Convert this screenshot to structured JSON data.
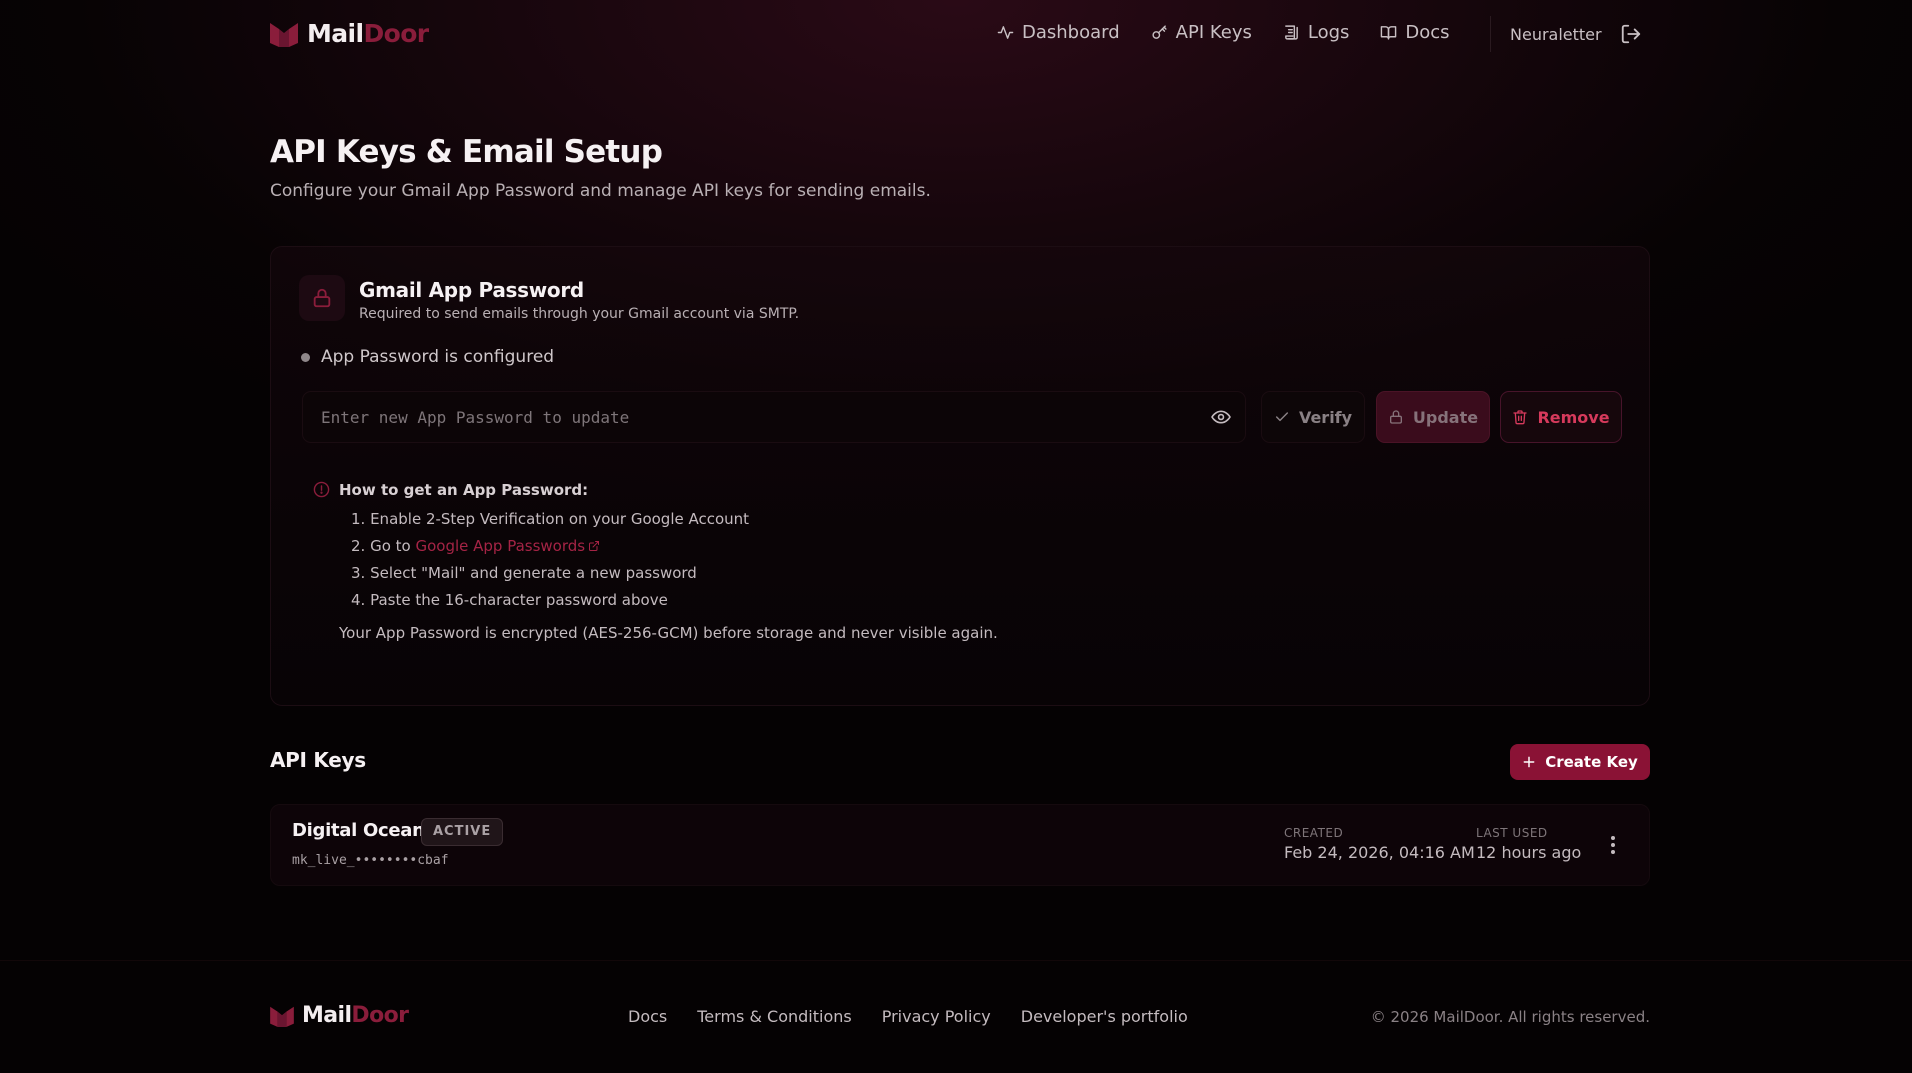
{
  "brand": {
    "name_part1": "Mail",
    "name_part2": "Door",
    "accent_color": "#8a1d3b"
  },
  "nav": {
    "items": [
      {
        "label": "Dashboard",
        "icon": "activity-icon"
      },
      {
        "label": "API Keys",
        "icon": "key-icon"
      },
      {
        "label": "Logs",
        "icon": "scroll-icon"
      },
      {
        "label": "Docs",
        "icon": "book-icon"
      }
    ],
    "user_name": "Neuraletter",
    "logout_icon": "logout-icon"
  },
  "page": {
    "title": "API Keys & Email Setup",
    "subtitle": "Configure your Gmail App Password and manage API keys for sending emails."
  },
  "gmail": {
    "title": "Gmail App Password",
    "description": "Required to send emails through your Gmail account via SMTP.",
    "status": "App Password is configured",
    "input_placeholder": "Enter new App Password to update",
    "input_value": "",
    "verify_label": "Verify",
    "update_label": "Update",
    "remove_label": "Remove",
    "help_title": "How to get an App Password:",
    "steps": [
      "1. Enable 2-Step Verification on your Google Account",
      "2. Go to ",
      "3. Select \"Mail\" and generate a new password",
      "4. Paste the 16-character password above"
    ],
    "step2_link": "Google App Passwords",
    "note": "Your App Password is encrypted (AES-256-GCM) before storage and never visible again."
  },
  "api_keys": {
    "title": "API Keys",
    "create_label": "Create Key",
    "keys": [
      {
        "name": "Digital Ocean",
        "status": "ACTIVE",
        "masked": "mk_live_••••••••cbaf",
        "created_label": "CREATED",
        "created": "Feb 24, 2026, 04:16 AM",
        "last_used_label": "LAST USED",
        "last_used": "12 hours ago"
      }
    ]
  },
  "footer": {
    "links": [
      "Docs",
      "Terms & Conditions",
      "Privacy Policy",
      "Developer's portfolio"
    ],
    "copyright": "© 2026 MailDoor. All rights reserved."
  }
}
